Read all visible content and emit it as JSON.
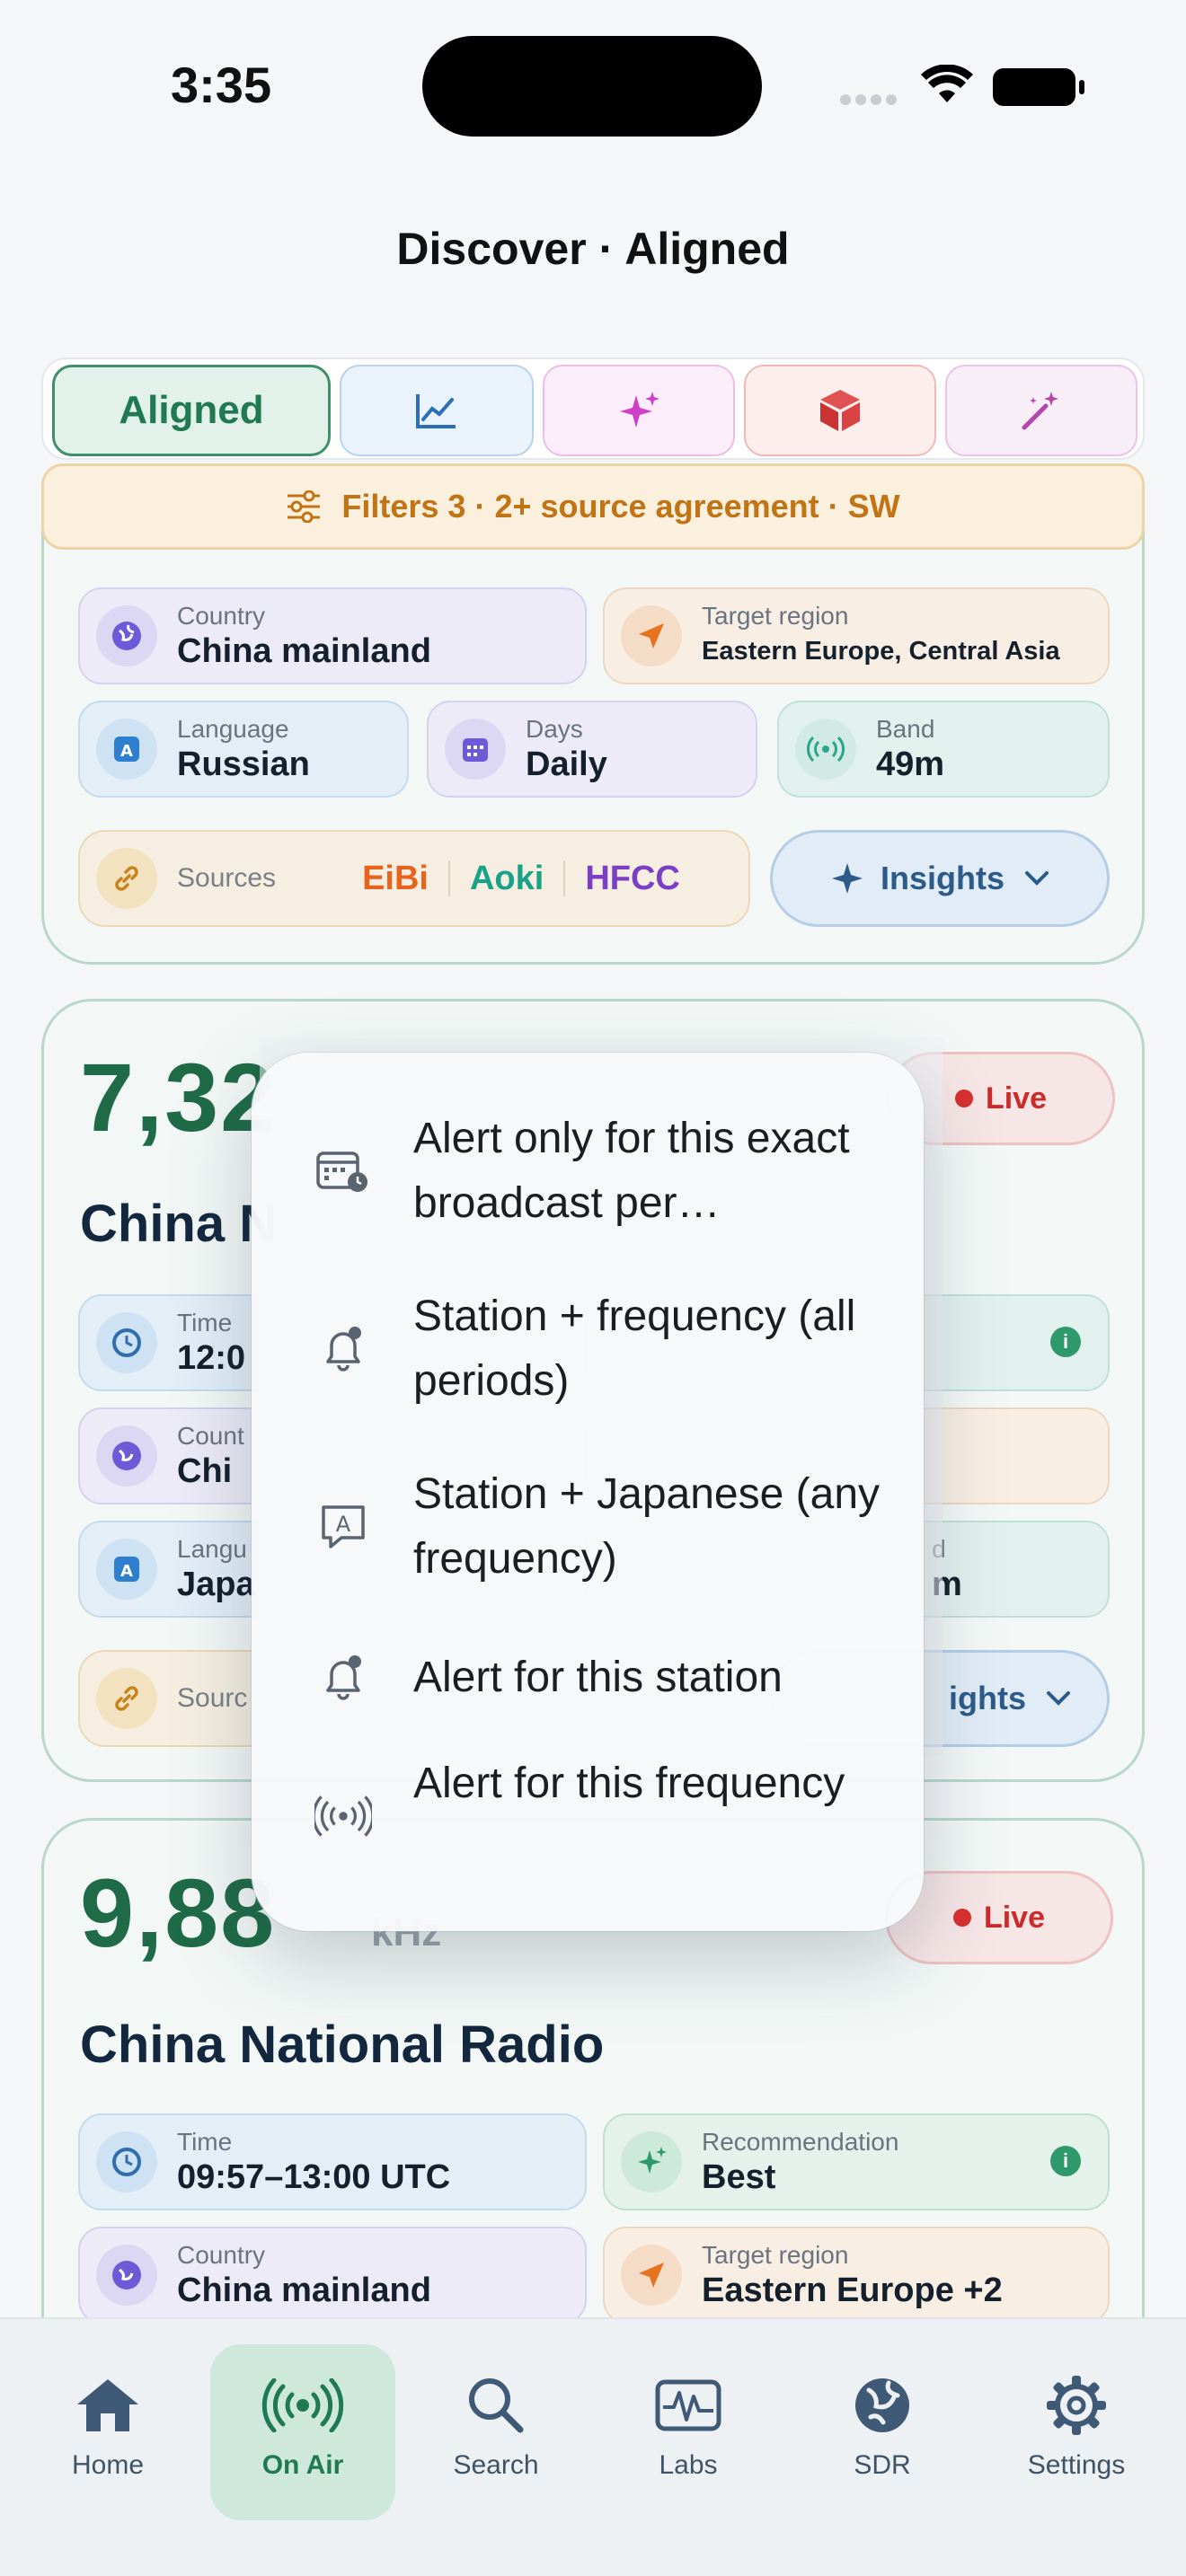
{
  "status": {
    "time": "3:35"
  },
  "title": "Discover · Aligned",
  "tabs": {
    "aligned_label": "Aligned",
    "icons": [
      "trend-chart-icon",
      "sparkles-icon",
      "cube-icon",
      "magic-wand-icon"
    ]
  },
  "filters": {
    "label": "Filters 3 · 2+ source agreement · SW"
  },
  "card1": {
    "country_label": "Country",
    "country": "China mainland",
    "target_label": "Target region",
    "target": "Eastern Europe, Central Asia",
    "language_label": "Language",
    "language": "Russian",
    "days_label": "Days",
    "days": "Daily",
    "band_label": "Band",
    "band": "49m",
    "sources_label": "Sources",
    "sources": [
      "EiBi",
      "Aoki",
      "HFCC"
    ],
    "insights_label": "Insights"
  },
  "card2": {
    "frequency": "7,32",
    "station": "China N",
    "live_label": "Live",
    "time_label": "Time",
    "time": "12:0",
    "country_label": "Count",
    "country": "Chi",
    "language_label": "Langu",
    "language": "Japa",
    "band_label": "d",
    "band": "m",
    "sources_label": "Sourc",
    "insights_label": "ights"
  },
  "menu": {
    "items": [
      {
        "label": "Alert only for this exact broadcast per…",
        "icon": "calendar-clock-icon"
      },
      {
        "label": "Station + frequency (all periods)",
        "icon": "bell-badge-icon"
      },
      {
        "label": "Station + Japanese (any frequency)",
        "icon": "translate-bubble-icon"
      },
      {
        "label": "Alert for this station",
        "icon": "bell-badge-icon"
      },
      {
        "label": "Alert for this frequency",
        "icon": "antenna-waves-icon"
      }
    ]
  },
  "card3": {
    "frequency": "9,88",
    "unit": "kHz",
    "station": "China National Radio",
    "live_label": "Live",
    "time_label": "Time",
    "time": "09:57–13:00 UTC",
    "rec_label": "Recommendation",
    "rec": "Best",
    "country_label": "Country",
    "country": "China mainland",
    "target_label": "Target region",
    "target": "Eastern Europe +2"
  },
  "tabbar": {
    "items": [
      "Home",
      "On Air",
      "Search",
      "Labs",
      "SDR",
      "Settings"
    ],
    "active": "On Air"
  },
  "colors": {
    "accent": "#1f7a52",
    "live": "#cc2b2b",
    "eibi": "#e8641e",
    "aoki": "#1aa18a",
    "hfcc": "#7a3fc4"
  }
}
